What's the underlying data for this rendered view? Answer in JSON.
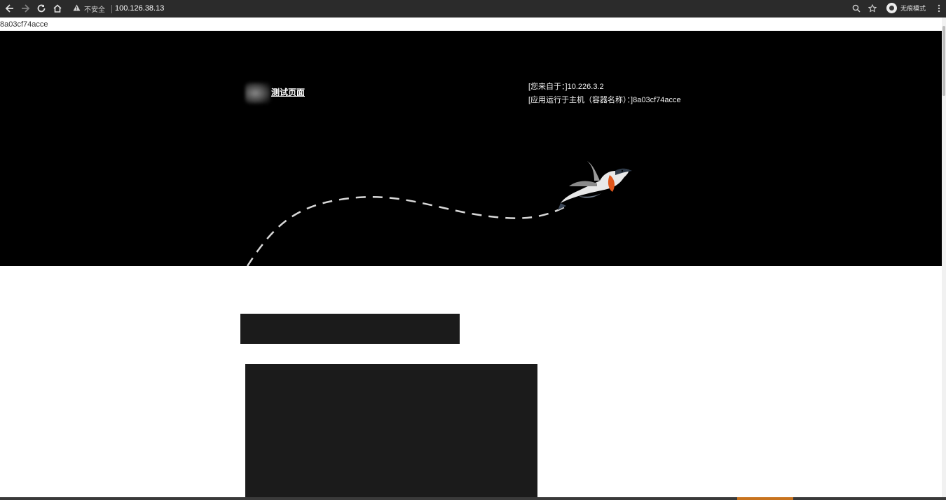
{
  "browser": {
    "security_label": "不安全",
    "url": "100.126.38.13",
    "profile_label": "无痕模式",
    "icons": [
      "back-icon",
      "forward-icon",
      "reload-icon",
      "home-icon",
      "warning-icon",
      "zoom-icon",
      "star-icon",
      "profile-icon",
      "menu-icon"
    ]
  },
  "page": {
    "host_header": "8a03cf74acce",
    "site_title": "测试页面",
    "client_ip_text": "[您来自于：]10.226.3.2",
    "container_text": "[应用运行于主机（容器名称）：]8a03cf74acce"
  },
  "colors": {
    "toolbar_bg": "#2b2b2b",
    "hero_bg": "#000000",
    "block_bg": "#1b1b1b",
    "accent": "#c8731f"
  }
}
